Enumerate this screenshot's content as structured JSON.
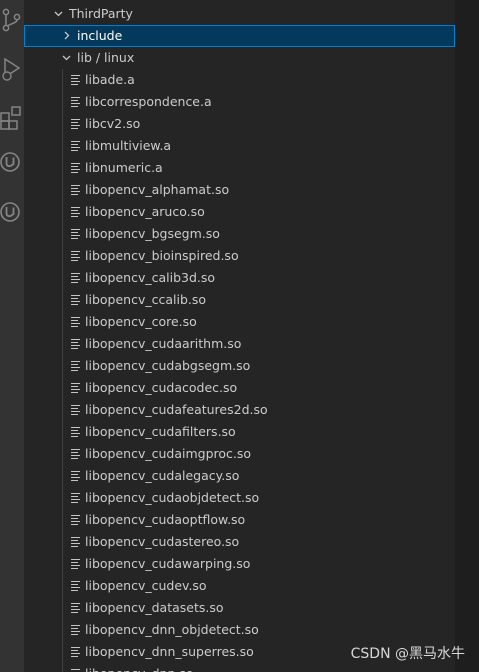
{
  "explorer": {
    "root_folder": "ThirdParty",
    "include_folder": "include",
    "lib_folder": "lib / linux",
    "files": [
      "libade.a",
      "libcorrespondence.a",
      "libcv2.so",
      "libmultiview.a",
      "libnumeric.a",
      "libopencv_alphamat.so",
      "libopencv_aruco.so",
      "libopencv_bgsegm.so",
      "libopencv_bioinspired.so",
      "libopencv_calib3d.so",
      "libopencv_ccalib.so",
      "libopencv_core.so",
      "libopencv_cudaarithm.so",
      "libopencv_cudabgsegm.so",
      "libopencv_cudacodec.so",
      "libopencv_cudafeatures2d.so",
      "libopencv_cudafilters.so",
      "libopencv_cudaimgproc.so",
      "libopencv_cudalegacy.so",
      "libopencv_cudaobjdetect.so",
      "libopencv_cudaoptflow.so",
      "libopencv_cudastereo.so",
      "libopencv_cudawarping.so",
      "libopencv_cudev.so",
      "libopencv_datasets.so",
      "libopencv_dnn_objdetect.so",
      "libopencv_dnn_superres.so",
      "libopencv_dnn.so"
    ]
  },
  "activity_bar": {
    "icons": [
      "source-control-icon",
      "run-debug-icon",
      "extensions-icon",
      "unreal-engine-icon",
      "unreal-engine-icon"
    ]
  },
  "watermark": "CSDN @黑马水牛",
  "colors": {
    "selection_background": "#04395e",
    "selection_border": "#007fd4",
    "sidebar_background": "#252526",
    "activity_bar_background": "#333333"
  }
}
